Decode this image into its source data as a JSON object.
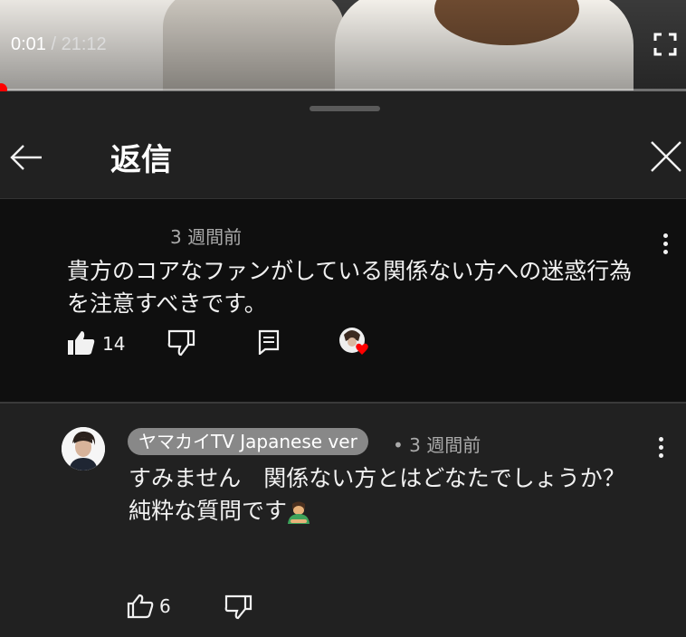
{
  "video": {
    "current_time": "0:01",
    "total_time": " / 21:12",
    "progress": 0.0008
  },
  "panel": {
    "title": "返信"
  },
  "parent_comment": {
    "time": "3 週間前",
    "text": "貴方のコアなファンがしている関係ない方への迷惑行為を注意すべきです。",
    "likes": "14"
  },
  "reply": {
    "channel": "ヤマカイTV Japanese ver",
    "time": "• 3 週間前",
    "line1": "すみません　関係ない方とはどなたでしょうか？",
    "line2": "純粋な質問です",
    "likes": "6"
  },
  "colors": {
    "background": "#212121",
    "parent_background": "#0f0f0f",
    "progress_red": "#ff0000",
    "heart_red": "#ff0000",
    "badge_gray": "#888888"
  },
  "icons": [
    "fullscreen-icon",
    "back-arrow-icon",
    "close-icon",
    "more-vert-icon",
    "thumb-up-filled-icon",
    "thumb-down-icon",
    "reply-icon",
    "creator-heart-icon",
    "thumb-up-outline-icon"
  ]
}
